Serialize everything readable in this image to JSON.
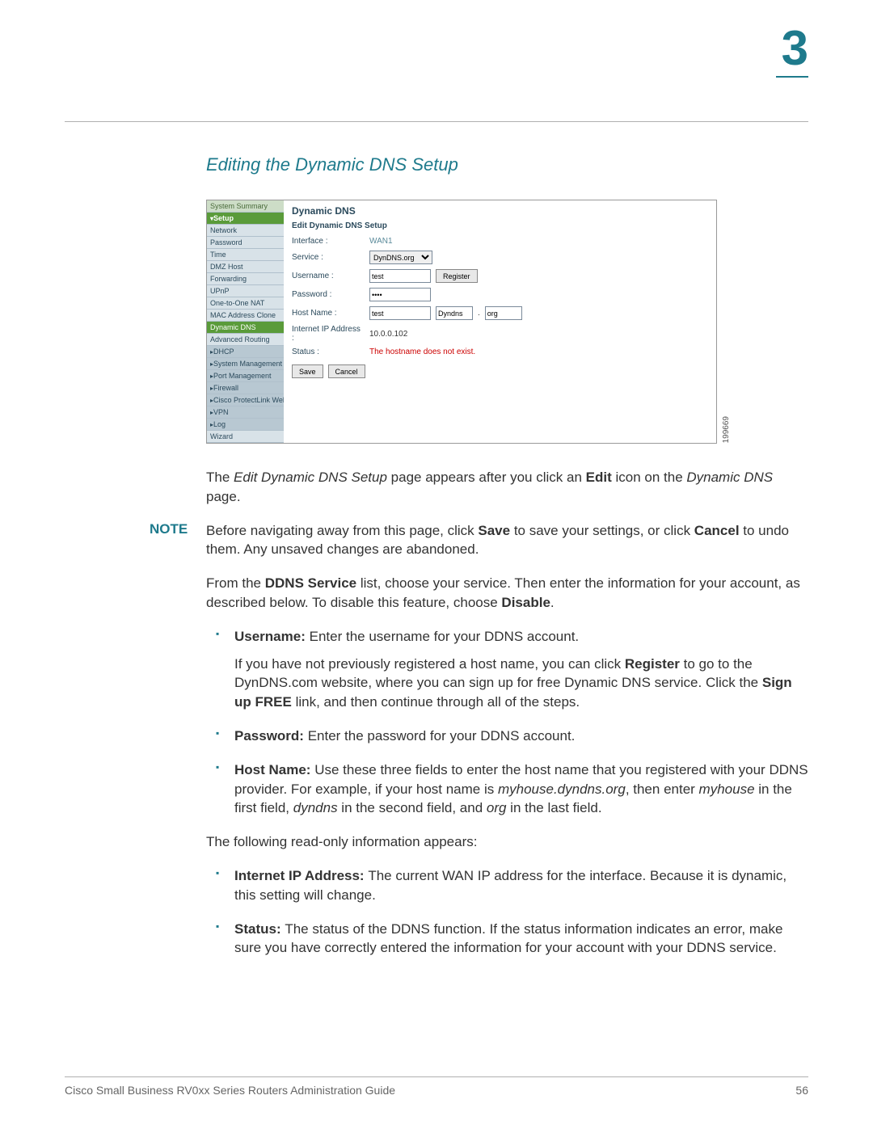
{
  "chapter_number": "3",
  "section_title": "Editing the Dynamic DNS Setup",
  "screenshot": {
    "code_label": "199669",
    "sidebar": {
      "summary": "System Summary",
      "setup": "Setup",
      "items": [
        "Network",
        "Password",
        "Time",
        "DMZ Host",
        "Forwarding",
        "UPnP",
        "One-to-One NAT",
        "MAC Address Clone"
      ],
      "active": "Dynamic DNS",
      "adv": "Advanced Routing",
      "groups": [
        "DHCP",
        "System Management",
        "Port Management",
        "Firewall",
        "Cisco ProtectLink Web",
        "VPN",
        "Log"
      ],
      "wizard": "Wizard"
    },
    "panel": {
      "title": "Dynamic DNS",
      "subtitle": "Edit Dynamic DNS Setup",
      "interface_label": "Interface :",
      "interface_value": "WAN1",
      "service_label": "Service :",
      "service_value": "DynDNS.org",
      "username_label": "Username :",
      "username_value": "test",
      "register_btn": "Register",
      "password_label": "Password :",
      "password_value": "••••",
      "hostname_label": "Host Name :",
      "host1": "test",
      "host2": "Dyndns",
      "host3": "org",
      "ip_label": "Internet IP Address :",
      "ip_value": "10.0.0.102",
      "status_label": "Status :",
      "status_value": "The hostname does not exist.",
      "save_btn": "Save",
      "cancel_btn": "Cancel"
    }
  },
  "para1_a": "The ",
  "para1_b": "Edit Dynamic DNS Setup",
  "para1_c": " page appears after you click an ",
  "para1_d": "Edit",
  "para1_e": " icon on the ",
  "para1_f": "Dynamic DNS",
  "para1_g": " page.",
  "note_label": "NOTE",
  "note_a": "Before navigating away from this page, click ",
  "note_b": "Save",
  "note_c": " to save your settings, or click ",
  "note_d": "Cancel",
  "note_e": " to undo them. Any unsaved changes are abandoned.",
  "para2_a": "From the ",
  "para2_b": "DDNS Service",
  "para2_c": " list, choose your service. Then enter the information for your account, as described below. To disable this feature, choose ",
  "para2_d": "Disable",
  "para2_e": ".",
  "li_user_a": "Username: ",
  "li_user_b": "Enter the username for your DDNS account.",
  "li_user_sub_a": "If you have not previously registered a host name, you can click ",
  "li_user_sub_b": "Register",
  "li_user_sub_c": " to go to the DynDNS.com website, where you can sign up for free Dynamic DNS service. Click the ",
  "li_user_sub_d": "Sign up FREE",
  "li_user_sub_e": " link, and then continue through all of the steps.",
  "li_pass_a": "Password: ",
  "li_pass_b": "Enter the password for your DDNS account.",
  "li_host_a": "Host Name: ",
  "li_host_b": "Use these three fields to enter the host name that you registered with your DDNS provider. For example, if your host name is ",
  "li_host_c": "myhouse.dyndns.org",
  "li_host_d": ", then enter ",
  "li_host_e": "myhouse",
  "li_host_f": " in the first field, ",
  "li_host_g": "dyndns",
  "li_host_h": " in the second field, and ",
  "li_host_i": "org",
  "li_host_j": " in the last field.",
  "para3": "The following read-only information appears:",
  "li_ip_a": "Internet IP Address: ",
  "li_ip_b": "The current WAN IP address for the interface. Because it is dynamic, this setting will change.",
  "li_status_a": "Status: ",
  "li_status_b": "The status of the DDNS function. If the status information indicates an error, make sure you have correctly entered the information for your account with your DDNS service.",
  "footer_title": "Cisco Small Business RV0xx Series Routers Administration Guide",
  "footer_page": "56"
}
